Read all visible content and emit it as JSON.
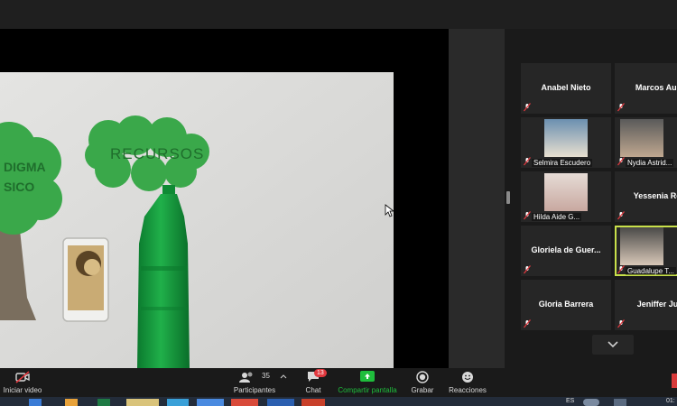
{
  "gallery": {
    "tiles": [
      {
        "name": "Anabel Nieto",
        "video": false
      },
      {
        "name": "Marcos  Aure",
        "video": false
      },
      {
        "name": "Selmira Escudero",
        "video": true
      },
      {
        "name": "Nydia  Astrid...",
        "video": true
      },
      {
        "name": "Hilda Aide G...",
        "video": true
      },
      {
        "name": "Yessenia  Rob",
        "video": false
      },
      {
        "name": "Gloriela  de  Guer...",
        "video": false
      },
      {
        "name": "Guadalupe T...",
        "video": true
      },
      {
        "name": "Gloria Barrera",
        "video": false
      },
      {
        "name": "Jeniffer Juá",
        "video": false
      }
    ]
  },
  "toolbar": {
    "start_video": "Iniciar video",
    "participants": "Participantes",
    "participants_count": "35",
    "chat": "Chat",
    "chat_badge": "13",
    "share_screen": "Compartir pantalla",
    "record": "Grabar",
    "reactions": "Reacciones"
  },
  "shared_content": {
    "cloud_left_text": "DIGMA\nSICO",
    "cloud_right_text": "RECURSOS"
  },
  "taskbar": {
    "tray_partial": "ES",
    "clock_partial": "01:"
  },
  "colors": {
    "share_green": "#1fbd3c",
    "active_speaker": "#c8e04a",
    "badge_red": "#e0383e",
    "tree_green": "#3aa84a",
    "bottle_green": "#12903a"
  }
}
